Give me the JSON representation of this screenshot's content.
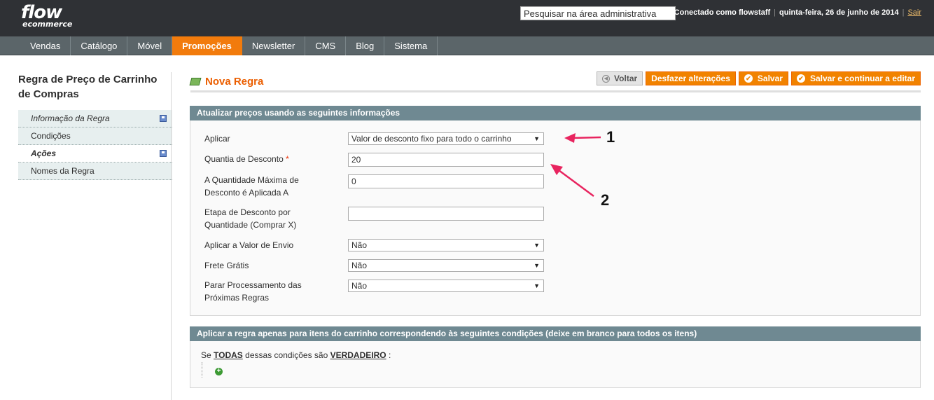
{
  "brand": {
    "name": "flow",
    "sub": "ecommerce"
  },
  "header": {
    "search_placeholder": "Pesquisar na área administrativa",
    "connected": "Conectado como flowstaff",
    "date": "quinta-feira, 26 de junho de 2014",
    "logout": "Sair"
  },
  "nav": {
    "items": [
      "Vendas",
      "Catálogo",
      "Móvel",
      "Promoções",
      "Newsletter",
      "CMS",
      "Blog",
      "Sistema"
    ],
    "active": "Promoções"
  },
  "sidebar": {
    "title": "Regra de Preço de Carrinho de Compras",
    "tabs": [
      "Informação da Regra",
      "Condições",
      "Ações",
      "Nomes da Regra"
    ],
    "active_tab": "Ações"
  },
  "page": {
    "title": "Nova Regra"
  },
  "buttons": {
    "back": "Voltar",
    "reset": "Desfazer alterações",
    "save": "Salvar",
    "save_continue": "Salvar e continuar a editar"
  },
  "actions_box": {
    "title": "Atualizar preços usando as seguintes informações",
    "fields": {
      "apply": {
        "label": "Aplicar",
        "value": "Valor de desconto fixo para todo o carrinho"
      },
      "discount_amount": {
        "label": "Quantia de Desconto",
        "required": "*",
        "value": "20"
      },
      "max_qty": {
        "label_1": "A Quantidade Máxima de",
        "label_2": "Desconto é Aplicada A",
        "value": "0"
      },
      "discount_step": {
        "label_1": "Etapa de Desconto por",
        "label_2": "Quantidade (Comprar X)",
        "value": ""
      },
      "apply_shipping": {
        "label": "Aplicar a Valor de Envio",
        "value": "Não"
      },
      "free_shipping": {
        "label": "Frete Grátis",
        "value": "Não"
      },
      "stop_rules": {
        "label_1": "Parar Processamento das",
        "label_2": "Próximas Regras",
        "value": "Não"
      }
    }
  },
  "conditions_box": {
    "title": "Aplicar a regra apenas para itens do carrinho correspondendo às seguintes condições (deixe em branco para todos os itens)",
    "prefix": "Se",
    "aggregator": "TODAS",
    "middle": "dessas condições são",
    "value": "VERDADEIRO",
    "suffix": ":"
  },
  "annotations": {
    "one": "1",
    "two": "2"
  },
  "colors": {
    "accent": "#f18200",
    "header_bg": "#2f3135",
    "nav_bg": "#5b6569",
    "box_head": "#6f8992",
    "arrow": "#e8245f"
  }
}
